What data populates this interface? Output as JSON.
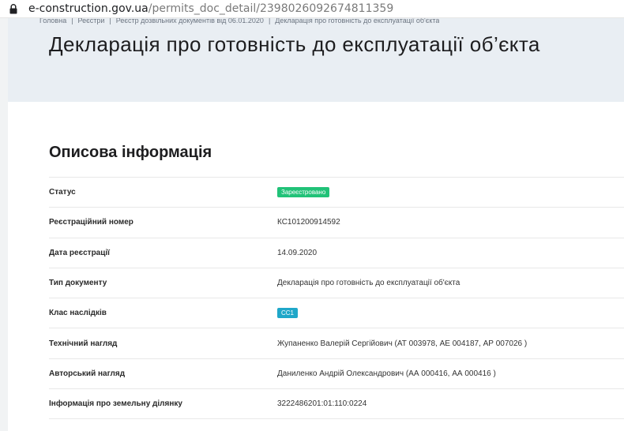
{
  "browser": {
    "url_host": "e-construction.gov.ua",
    "url_path": "/permits_doc_detail/2398026092674811359",
    "lock_icon": "lock-icon"
  },
  "breadcrumb": [
    "Головна",
    "Реєстри",
    "Реєстр дозвільних документів від 06.01.2020",
    "Декларація про готовність до експлуатації об'єкта"
  ],
  "page_title": "Декларація про готовність до експлуатації об’єкта",
  "section_title": "Описова інформація",
  "colors": {
    "status_badge": "#21c278",
    "class_badge": "#1fa7c9",
    "hero_bg": "#e9eef3"
  },
  "rows": [
    {
      "label": "Статус",
      "value": "Зареєстровано",
      "kind": "badge-green"
    },
    {
      "label": "Реєстраційний номер",
      "value": "КС101200914592",
      "kind": "text"
    },
    {
      "label": "Дата реєстрації",
      "value": "14.09.2020",
      "kind": "text"
    },
    {
      "label": "Тип документу",
      "value": "Декларація про готовність до експлуатації об'єкта",
      "kind": "text"
    },
    {
      "label": "Клас наслідків",
      "value": "СС1",
      "kind": "badge-teal"
    },
    {
      "label": "Технічний нагляд",
      "value": "Жупаненко Валерій Сергійович (АТ 003978, АЕ 004187, АР 007026 )",
      "kind": "text"
    },
    {
      "label": "Авторський нагляд",
      "value": "Даниленко Андрій Олександрович (АА 000416, АА 000416 )",
      "kind": "text"
    },
    {
      "label": "Інформація про земельну ділянку",
      "value": "3222486201:01:110:0224",
      "kind": "text"
    }
  ]
}
